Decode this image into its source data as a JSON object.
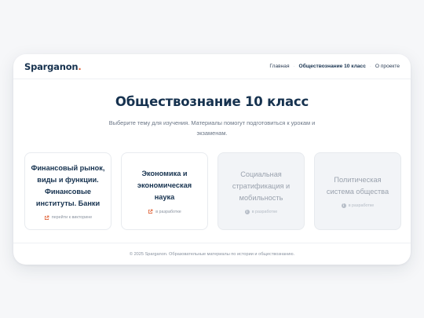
{
  "header": {
    "brand": "Sparganon",
    "brand_dot": ".",
    "nav": [
      {
        "label": "Главная"
      },
      {
        "label": "Обществознание 10 класс"
      },
      {
        "label": "О проекте"
      }
    ]
  },
  "hero": {
    "title": "Обществознание 10 класс",
    "subtitle": "Выберите тему для изучения. Материалы помогут подготовиться к урокам и экзаменам."
  },
  "cards": [
    {
      "title": "Финансовый рынок, виды и функции. Финансовые институты. Банки",
      "status": "перейти к викторине",
      "icon": "external-link-icon"
    },
    {
      "title": "Экономика и экономическая наука",
      "status": "в разработке",
      "icon": "external-link-icon"
    },
    {
      "title": "Социальная стратификация и мобильность",
      "status": "в разработке",
      "icon": "info-icon"
    },
    {
      "title": "Политическая система общества",
      "status": "в разработке",
      "icon": "info-icon"
    }
  ],
  "footer": {
    "text": "© 2025 Sparganon. Образовательные материалы по истории и обществознанию."
  },
  "colors": {
    "accent": "#e0643a",
    "heading": "#16324f"
  }
}
